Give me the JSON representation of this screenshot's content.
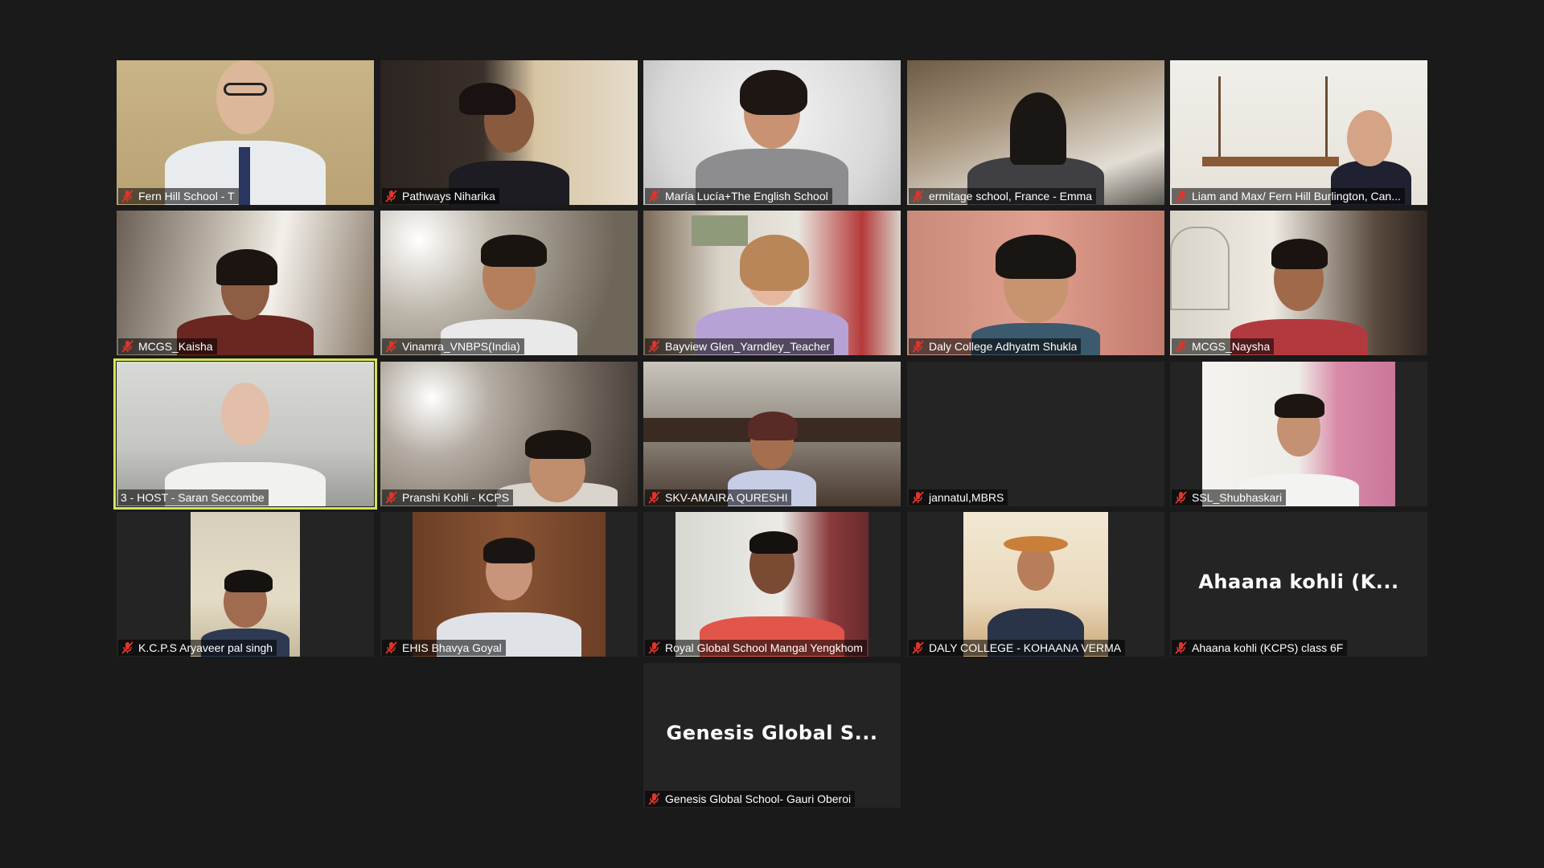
{
  "participants": [
    {
      "name": "Fern Hill School - T",
      "muted": true
    },
    {
      "name": "Pathways Niharika",
      "muted": true
    },
    {
      "name": "María Lucía+The English School",
      "muted": true
    },
    {
      "name": "ermitage school, France - Emma",
      "muted": true
    },
    {
      "name": "Liam and Max/ Fern Hill Burlington, Can...",
      "muted": true
    },
    {
      "name": "MCGS_Kaisha",
      "muted": true
    },
    {
      "name": "Vinamra_VNBPS(India)",
      "muted": true
    },
    {
      "name": "Bayview Glen_Yarndley_Teacher",
      "muted": true
    },
    {
      "name": "Daly College Adhyatm Shukla",
      "muted": true
    },
    {
      "name": "MCGS_Naysha",
      "muted": true
    },
    {
      "name": "3 - HOST - Saran Seccombe",
      "muted": false,
      "speaking": true
    },
    {
      "name": "Pranshi Kohli - KCPS",
      "muted": true
    },
    {
      "name": "SKV-AMAIRA QURESHI",
      "muted": true
    },
    {
      "name": "jannatul,MBRS",
      "muted": true
    },
    {
      "name": "SSL_Shubhaskari",
      "muted": true
    },
    {
      "name": "K.C.P.S Aryaveer pal singh",
      "muted": true
    },
    {
      "name": "EHIS Bhavya Goyal",
      "muted": true
    },
    {
      "name": "Royal Global School Mangal Yengkhom",
      "muted": true
    },
    {
      "name": "DALY COLLEGE - KOHAANA VERMA",
      "muted": true
    },
    {
      "name": "Ahaana kohli (KCPS) class 6F",
      "muted": true,
      "video_off_label": "Ahaana kohli (K..."
    },
    {
      "name": "Genesis Global School- Gauri Oberoi",
      "muted": true,
      "video_off_label": "Genesis Global S..."
    }
  ],
  "icons": {
    "muted_mic": "mic-muted-icon"
  },
  "colors": {
    "background": "#1a1a1a",
    "tile_empty": "#242424",
    "active_speaker_border": "#d6e35a",
    "muted_icon": "#e0352b",
    "name_text": "#ffffff"
  }
}
